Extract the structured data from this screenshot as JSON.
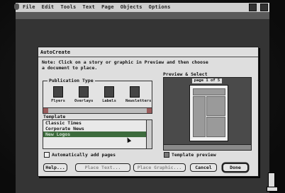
{
  "menubar": {
    "items": [
      "File",
      "Edit",
      "Tools",
      "Text",
      "Page",
      "Objects",
      "Options"
    ]
  },
  "dialog": {
    "title": "AutoCreate",
    "note": "Note: Click on a story or graphic in Preview and then choose a document to place.",
    "publication_type": {
      "label": "Publication Type",
      "items": [
        "Flyers",
        "Overlays",
        "Labels",
        "Newsletters"
      ]
    },
    "template": {
      "label": "Template",
      "items": [
        "Classic Times",
        "Corporate News",
        "New Logos"
      ],
      "selected_index": 2
    },
    "auto_add_pages": {
      "label": "Automatically add pages",
      "checked": false
    },
    "preview": {
      "title": "Preview & Select",
      "caption": "page 1 of 5"
    },
    "template_preview": {
      "label": "Template preview",
      "checked": true
    },
    "buttons": {
      "help": "Help...",
      "place_text": "Place Text...",
      "place_graphic": "Place Graphic...",
      "cancel": "Cancel",
      "done": "Done"
    }
  }
}
